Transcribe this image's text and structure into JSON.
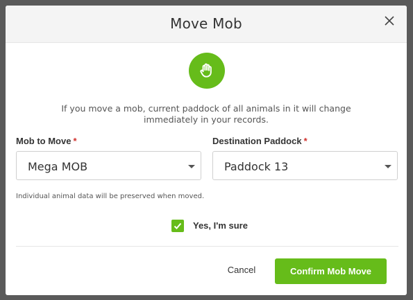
{
  "dialog": {
    "title": "Move Mob",
    "close_icon": "close-icon",
    "hand_icon": "hand-icon",
    "message": "If you move a mob, current paddock of all animals in it will change immediately in your records.",
    "mob_field": {
      "label": "Mob to Move",
      "required_marker": "*",
      "value": "Mega MOB"
    },
    "paddock_field": {
      "label": "Destination Paddock",
      "required_marker": "*",
      "value": "Paddock 13"
    },
    "note": "Individual animal data will be preserved when moved.",
    "confirm_checkbox": {
      "label": "Yes, I'm sure",
      "checked": true
    },
    "cancel_label": "Cancel",
    "confirm_label": "Confirm Mob Move"
  },
  "colors": {
    "accent": "#66bc1a",
    "required": "#d0312d",
    "header_bg": "#f4f4f4"
  }
}
